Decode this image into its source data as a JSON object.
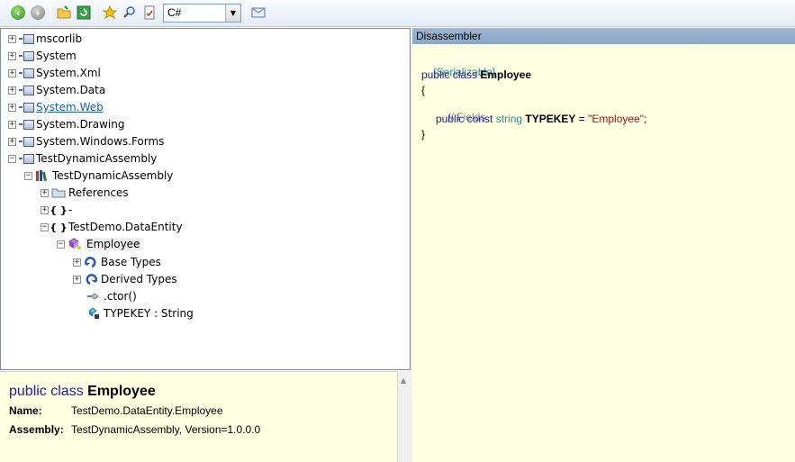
{
  "toolbar": {
    "language": "C#",
    "icons": [
      "back-icon",
      "forward-icon",
      "open-icon",
      "refresh-icon",
      "favorite-icon",
      "search-icon",
      "analyze-icon",
      "dropdown-arrow-icon",
      "options-icon"
    ]
  },
  "tree": {
    "items": [
      {
        "label": "mscorlib",
        "expander": "+"
      },
      {
        "label": "System",
        "expander": "+"
      },
      {
        "label": "System.Xml",
        "expander": "+"
      },
      {
        "label": "System.Data",
        "expander": "+"
      },
      {
        "label": "System.Web",
        "expander": "+"
      },
      {
        "label": "System.Drawing",
        "expander": "+"
      },
      {
        "label": "System.Windows.Forms",
        "expander": "+"
      },
      {
        "label": "TestDynamicAssembly",
        "expander": "−"
      },
      {
        "label": "TestDynamicAssembly",
        "expander": "−"
      },
      {
        "label": "References",
        "expander": "+"
      },
      {
        "label": "{ }",
        "extra": "-",
        "expander": "+"
      },
      {
        "label": "TestDemo.DataEntity",
        "expander": "−"
      },
      {
        "label": "Employee",
        "expander": "−"
      },
      {
        "label": "Base Types",
        "expander": "+"
      },
      {
        "label": "Derived Types",
        "expander": "+"
      },
      {
        "label": ".ctor()"
      },
      {
        "label": "TYPEKEY : String"
      }
    ]
  },
  "description": {
    "title_kw": "public class",
    "title_name": "Employee",
    "name_label": "Name:",
    "name_value": "TestDemo.DataEntity.Employee",
    "assembly_label": "Assembly:",
    "assembly_value": "TestDynamicAssembly, Version=1.0.0.0"
  },
  "disassembler": {
    "header": "Disassembler",
    "attr": "[Serializable]",
    "class_kw": "public class",
    "class_name": "Employee",
    "open_brace": "{",
    "comment": "// Fields",
    "field_kw": "public const",
    "field_type": "string",
    "field_name": "TYPEKEY",
    "field_eq": " = ",
    "field_value": "\"Employee\"",
    "field_end": ";",
    "close_brace": "}"
  }
}
